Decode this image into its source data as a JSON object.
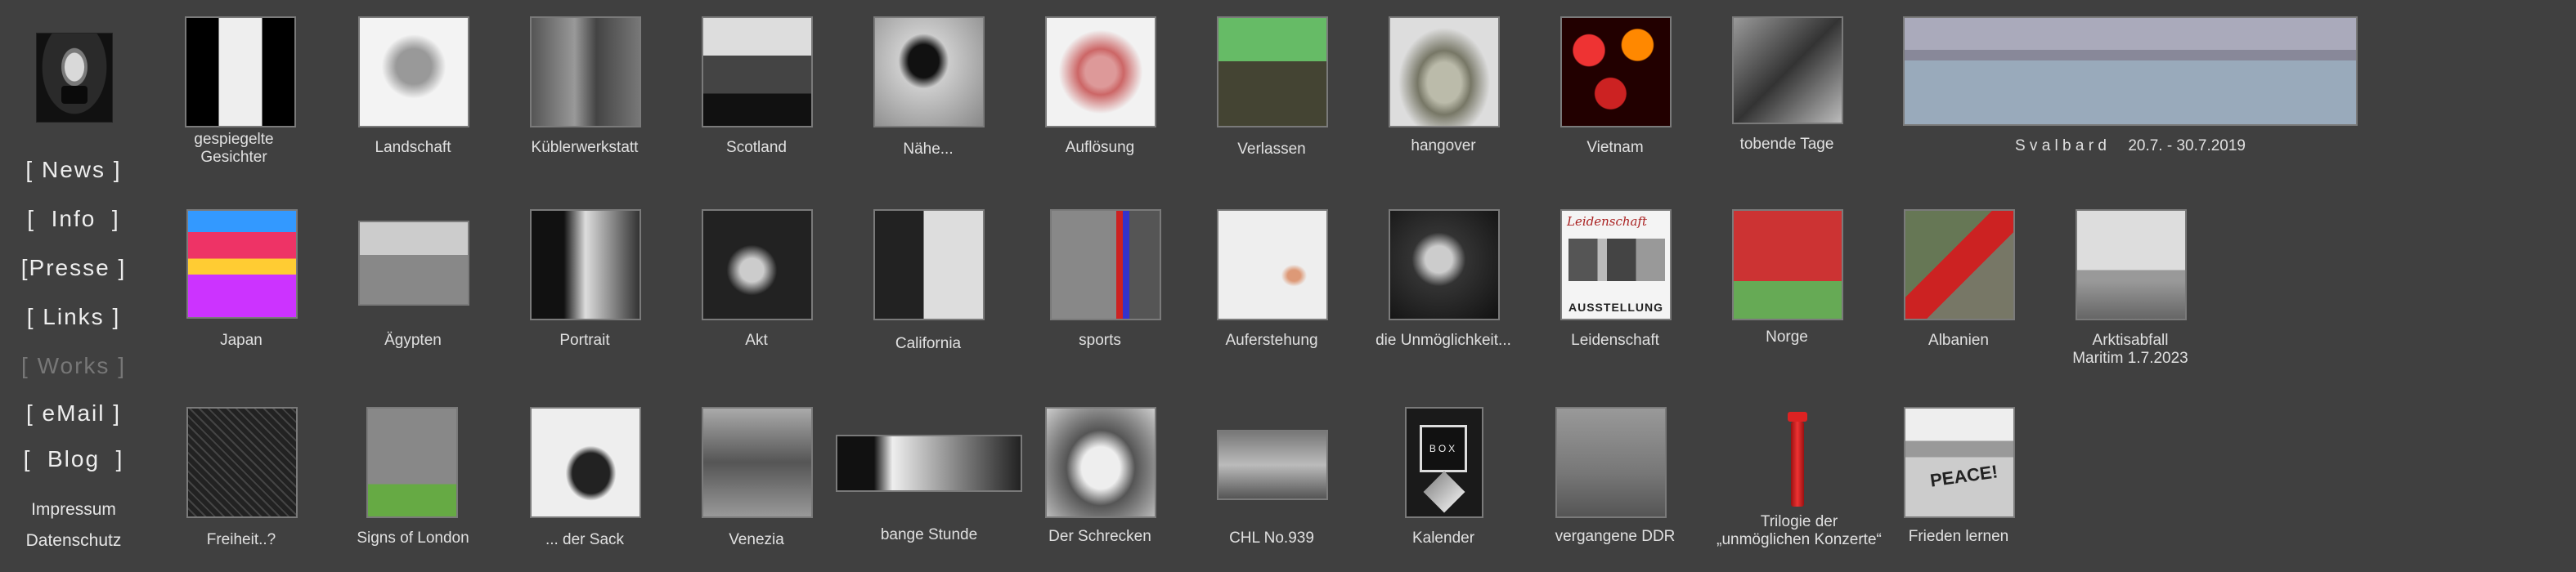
{
  "sidebar": {
    "nav": [
      "[ News ]",
      "[  Info  ]",
      "[Presse ]",
      "[ Links ]",
      "[ Works ]",
      "[ eMail ]",
      "[  Blog  ]"
    ],
    "impressum": "Impressum",
    "datenschutz": "Datenschutz"
  },
  "gallery": {
    "row1": [
      "gespiegelte\nGesichter",
      "Landschaft",
      "Küblerwerkstatt",
      "Scotland",
      "Nähe...",
      "Auflösung",
      "Verlassen",
      "hangover",
      "Vietnam",
      "tobende Tage"
    ],
    "svalbard": "S v a l b a r d     20.7. - 30.7.2019",
    "row2": [
      "Japan",
      "Ägypten",
      "Portrait",
      "Akt",
      "California",
      "sports",
      "Auferstehung",
      "die Unmöglichkeit...",
      "Leidenschaft",
      "Norge",
      "Albanien",
      "Arktisabfall\nMaritim 1.7.2023"
    ],
    "row3": [
      "Freiheit..?",
      "Signs of London",
      "... der Sack",
      "Venezia",
      "bange Stunde",
      "Der Schrecken",
      "CHL No.939",
      "Kalender",
      "vergangene DDR",
      "Trilogie der\n„unmöglichen Konzerte“",
      "Frieden lernen"
    ],
    "thumb_text": {
      "leidenschaft_title": "Leidenschaft",
      "leidenschaft_banner": "AUSSTELLUNG",
      "box": "BOX",
      "peace": "PEACE!"
    }
  }
}
